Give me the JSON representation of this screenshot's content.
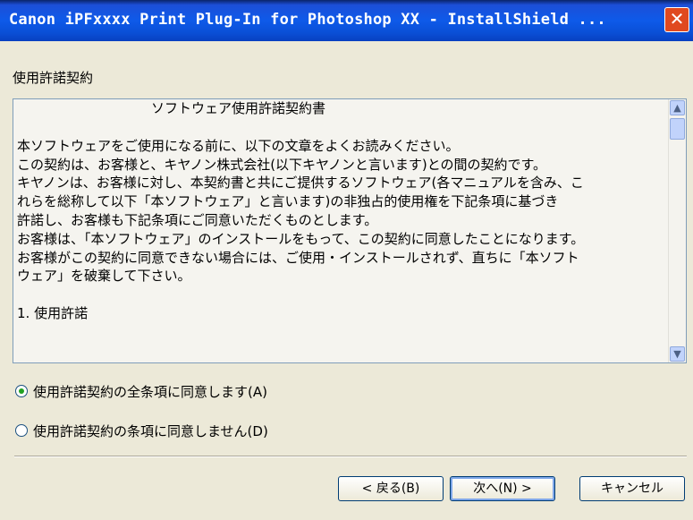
{
  "window": {
    "title": "Canon iPFxxxx Print Plug-In for Photoshop XX - InstallShield ...",
    "close_glyph": "✕"
  },
  "section_label": "使用許諾契約",
  "license": {
    "lines": [
      "ソフトウェア使用許諾契約書",
      "",
      "本ソフトウェアをご使用になる前に、以下の文章をよくお読みください。",
      "この契約は、お客様と、キヤノン株式会社(以下キヤノンと言います)との間の契約です。",
      "キヤノンは、お客様に対し、本契約書と共にご提供するソフトウェア(各マニュアルを含み、こ",
      "れらを総称して以下「本ソフトウェア」と言います)の非独占的使用権を下記条項に基づき",
      "許諾し、お客様も下記条項にご同意いただくものとします。",
      "お客様は、「本ソフトウェア」のインストールをもって、この契約に同意したことになります。",
      "お客様がこの契約に同意できない場合には、ご使用・インストールされず、直ちに「本ソフト",
      "ウェア」を破棄して下さい。",
      "",
      "1. 使用許諾"
    ]
  },
  "radios": [
    {
      "label": "使用許諾契約の全条項に同意します(A)",
      "checked": true
    },
    {
      "label": "使用許諾契約の条項に同意しません(D)",
      "checked": false
    }
  ],
  "buttons": {
    "back": "< 戻る(B)",
    "next": "次へ(N) >",
    "cancel": "キャンセル"
  },
  "icons": {
    "scroll_up": "▲",
    "scroll_down": "▼"
  }
}
